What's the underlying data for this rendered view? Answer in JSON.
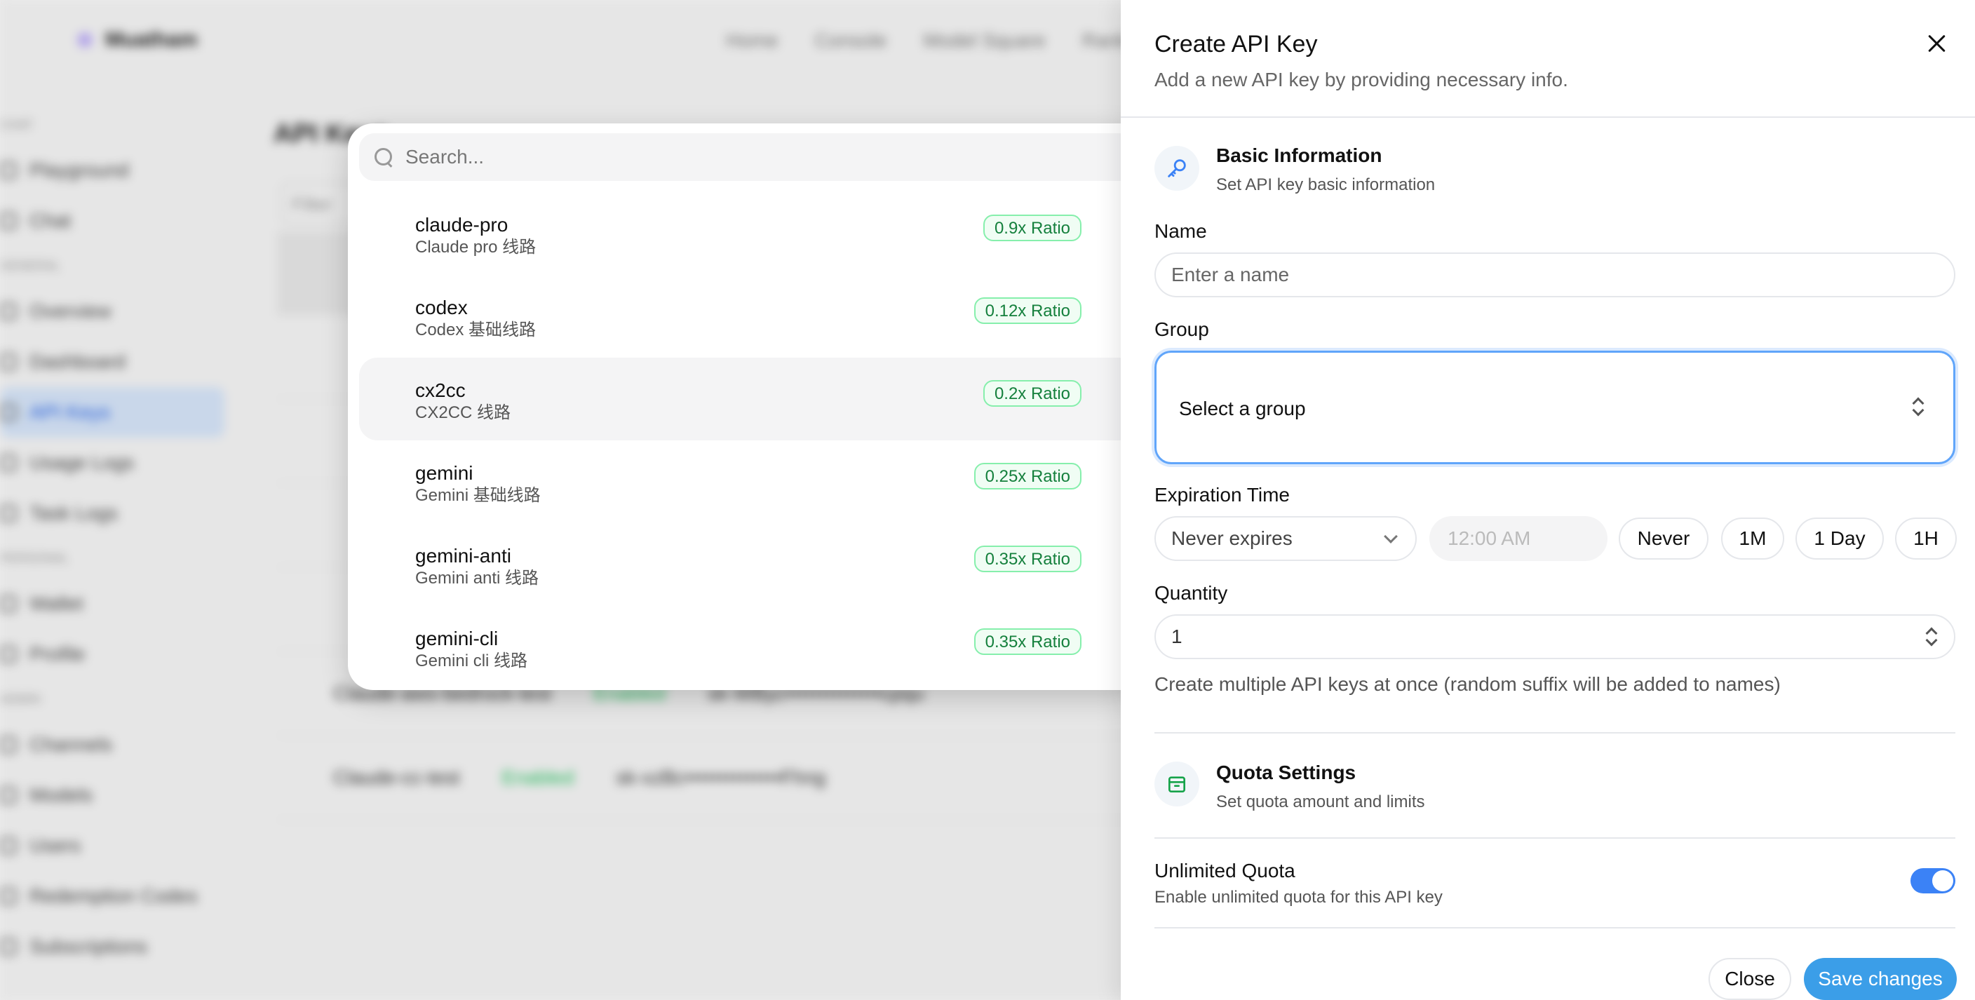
{
  "background": {
    "brand": "Muatham",
    "top_nav": [
      "Home",
      "Console",
      "Model Square",
      "Rank"
    ],
    "sidebar": [
      {
        "section": "Chat"
      },
      {
        "label": "Playground"
      },
      {
        "label": "Chat"
      },
      {
        "section": "General"
      },
      {
        "label": "Overview"
      },
      {
        "label": "Dashboard"
      },
      {
        "label": "API Keys",
        "active": true
      },
      {
        "label": "Usage Logs"
      },
      {
        "label": "Task Logs"
      },
      {
        "section": "Personal"
      },
      {
        "label": "Wallet"
      },
      {
        "label": "Profile"
      },
      {
        "section": "Admin"
      },
      {
        "label": "Channels"
      },
      {
        "label": "Models"
      },
      {
        "label": "Users"
      },
      {
        "label": "Redemption Codes"
      },
      {
        "label": "Subscriptions"
      }
    ],
    "page_title": "API Keys",
    "filter_placeholder": "Filter",
    "rows": [
      {
        "name": "",
        "status": "",
        "key": ""
      },
      {
        "name": "",
        "status": "",
        "key": ""
      },
      {
        "name": "",
        "status": "",
        "key": ""
      },
      {
        "name": "",
        "status": "",
        "key": ""
      },
      {
        "name": "",
        "status": "",
        "key": ""
      },
      {
        "name": "Claude-aws-bedrock-test",
        "status": "Enabled",
        "key": "sk-WByc••••••••••••••cpqu"
      },
      {
        "name": "Claude-cc-test",
        "status": "Enabled",
        "key": "sk-xzBc••••••••••••••Fhng"
      }
    ]
  },
  "dropdown": {
    "search_placeholder": "Search...",
    "options": [
      {
        "name": "claude-pro",
        "desc": "Claude pro 线路",
        "ratio": "0.9x Ratio",
        "selected": false
      },
      {
        "name": "codex",
        "desc": "Codex 基础线路",
        "ratio": "0.12x Ratio",
        "selected": false
      },
      {
        "name": "cx2cc",
        "desc": "CX2CC 线路",
        "ratio": "0.2x Ratio",
        "selected": true
      },
      {
        "name": "gemini",
        "desc": "Gemini 基础线路",
        "ratio": "0.25x Ratio",
        "selected": false
      },
      {
        "name": "gemini-anti",
        "desc": "Gemini anti 线路",
        "ratio": "0.35x Ratio",
        "selected": false
      },
      {
        "name": "gemini-cli",
        "desc": "Gemini cli 线路",
        "ratio": "0.35x Ratio",
        "selected": false
      }
    ]
  },
  "drawer": {
    "title": "Create API Key",
    "subtitle": "Add a new API key by providing necessary info.",
    "basic": {
      "icon": "key-icon",
      "title": "Basic Information",
      "subtitle": "Set API key basic information"
    },
    "name_label": "Name",
    "name_placeholder": "Enter a name",
    "group_label": "Group",
    "group_value": "Select a group",
    "expiration_label": "Expiration Time",
    "expiration_value": "Never expires",
    "time_placeholder": "12:00 AM",
    "presets": [
      "Never",
      "1M",
      "1 Day",
      "1H"
    ],
    "quantity_label": "Quantity",
    "quantity_value": "1",
    "quantity_help": "Create multiple API keys at once (random suffix will be added to names)",
    "quota": {
      "icon": "wallet-icon",
      "title": "Quota Settings",
      "subtitle": "Set quota amount and limits"
    },
    "unlimited_title": "Unlimited Quota",
    "unlimited_desc": "Enable unlimited quota for this API key",
    "unlimited_on": true,
    "close_label": "Close",
    "save_label": "Save changes",
    "accent": "#3b9ee8"
  }
}
